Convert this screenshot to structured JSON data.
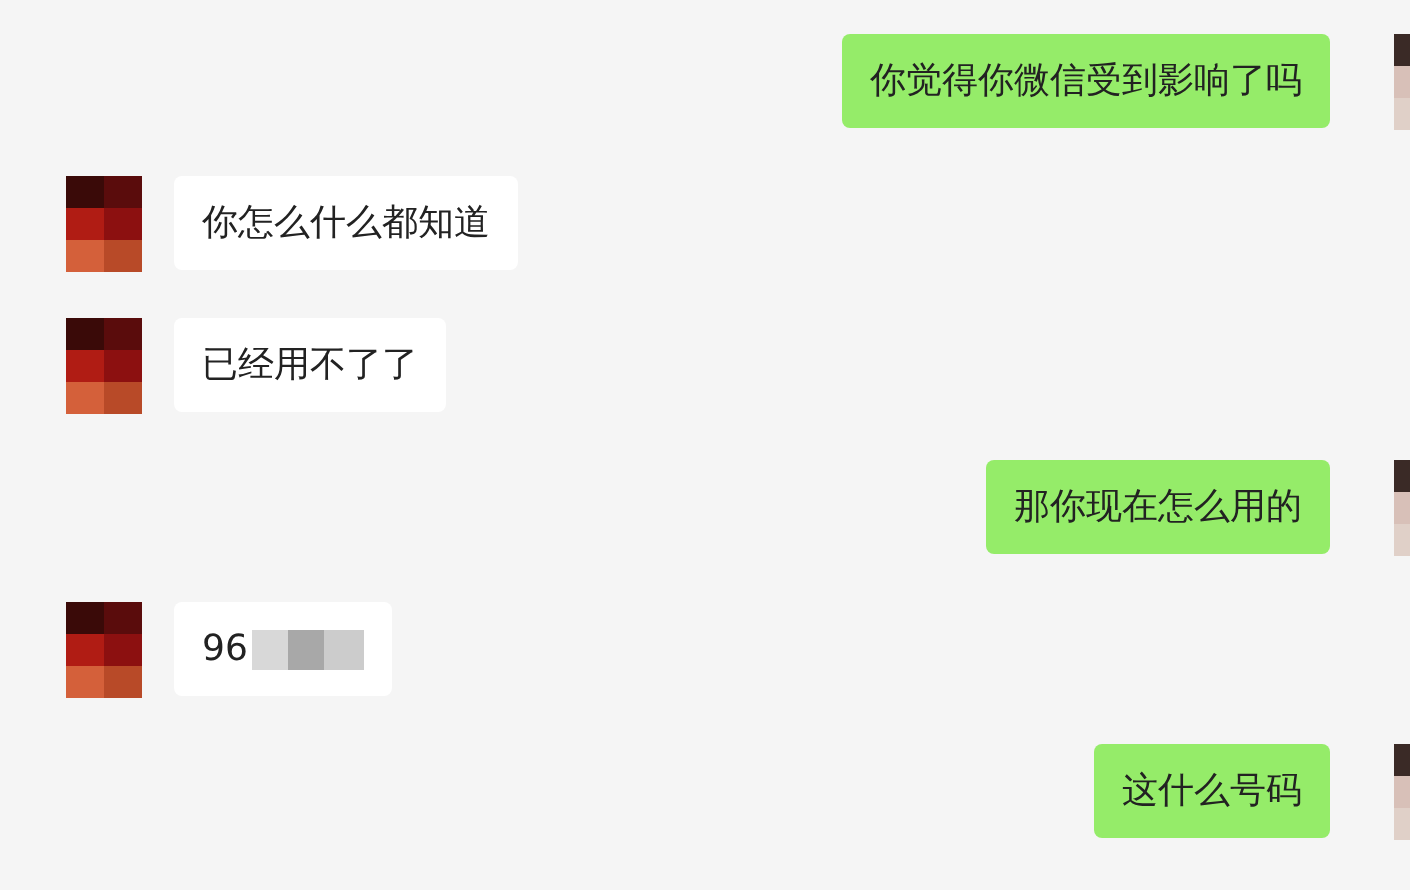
{
  "messages": [
    {
      "kind": "sent",
      "text": "你觉得你微信受到影响了吗",
      "redacted": false
    },
    {
      "kind": "received",
      "text": "你怎么什么都知道",
      "redacted": false
    },
    {
      "kind": "received",
      "text": "已经用不了了",
      "redacted": false
    },
    {
      "kind": "sent",
      "text": "那你现在怎么用的",
      "redacted": false
    },
    {
      "kind": "received",
      "text": "96",
      "redacted": true
    },
    {
      "kind": "sent",
      "text": "这什么号码",
      "redacted": false
    }
  ]
}
